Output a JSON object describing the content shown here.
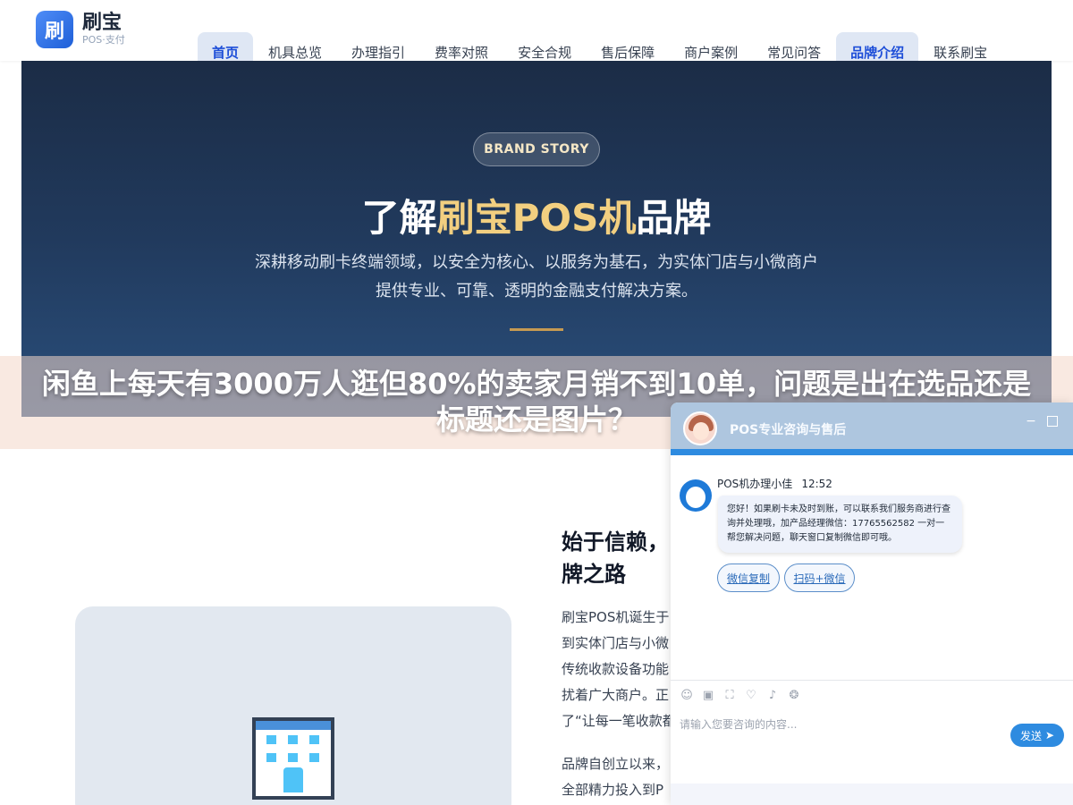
{
  "logo": {
    "mark": "刷",
    "title": "刷宝",
    "subtitle": "POS·支付"
  },
  "nav": {
    "items": [
      "首页",
      "机具总览",
      "办理指引",
      "费率对照",
      "安全合规",
      "售后保障",
      "商户案例",
      "常见问答",
      "品牌介绍",
      "联系刷宝"
    ],
    "active": [
      "首页",
      "品牌介绍"
    ]
  },
  "hero": {
    "badge": "BRAND STORY",
    "title_pre": "了解",
    "title_highlight": "刷宝POS机",
    "title_post": "品牌",
    "description": "深耕移动刷卡终端领域，以安全为核心、以服务为基石，为实体门店与小微商户提供专业、可靠、透明的金融支付解决方案。"
  },
  "overlay": {
    "text": "闲鱼上每天有3000万人逛但80%的卖家月销不到10单，问题是出在选品还是标题还是图片？"
  },
  "section": {
    "title": "始于信赖，\n牌之路",
    "para1_lines": [
      "刷宝POS机诞生于",
      "到实体门店与小微",
      "传统收款设备功能",
      "扰着广大商户。正",
      "了“让每一笔收款都"
    ],
    "para2_lines": [
      "品牌自创立以来，",
      "全部精力投入到P"
    ]
  },
  "chat": {
    "title": "POS专业咨询与售后",
    "sender": "POS机办理小佳",
    "time": "12:52",
    "message": "您好！如果刷卡未及时到账，可以联系我们服务商进行查询并处理哦，加产品经理微信：17765562582 一对一帮您解决问题，聊天窗口复制微信即可哦。",
    "quick_buttons": [
      "微信复制",
      "扫码+微信"
    ],
    "input_placeholder": "请输入您要咨询的内容...",
    "send_label": "发送",
    "tools": [
      "emoji-icon",
      "image-icon",
      "crop-icon",
      "shield-icon",
      "volume-icon",
      "chat-icon"
    ]
  },
  "colors": {
    "accent": "#2563eb",
    "hero_bg": "#213a5d",
    "gold": "#f2cf80",
    "chat_header": "#aec6df",
    "chat_accent": "#2e8be0"
  }
}
